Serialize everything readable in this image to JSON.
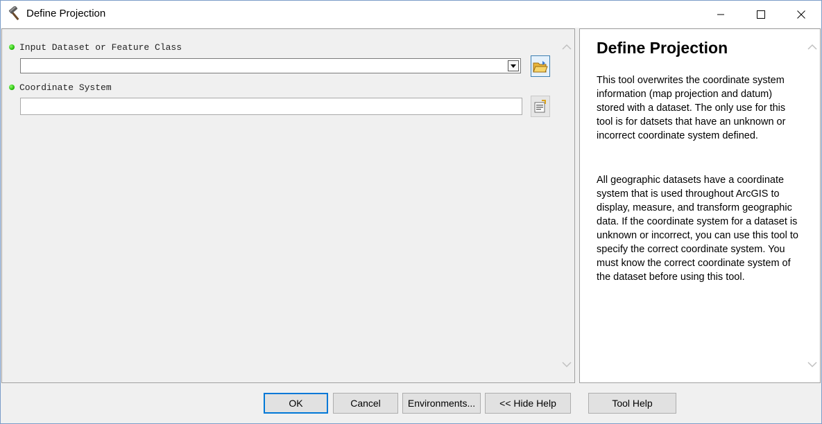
{
  "window": {
    "title": "Define Projection",
    "icon": "hammer-icon"
  },
  "parameters": {
    "input_label": "Input Dataset or Feature Class",
    "input_value": "",
    "coord_label": "Coordinate System",
    "coord_value": ""
  },
  "help": {
    "title": "Define Projection",
    "paragraph1": "This tool overwrites the coordinate system information (map projection and datum) stored with a dataset. The only use for this tool is for datsets that have an unknown or incorrect coordinate system defined.",
    "paragraph2": "All geographic datasets have a coordinate system that is used throughout ArcGIS to display, measure, and transform geographic data. If the coordinate system for a dataset is unknown or incorrect, you can use this tool to specify the correct coordinate system. You must know the correct coordinate system of the dataset before using this tool."
  },
  "buttons": {
    "ok": "OK",
    "cancel": "Cancel",
    "environments": "Environments...",
    "hide_help": "<< Hide Help",
    "tool_help": "Tool Help"
  },
  "colors": {
    "required_indicator": "#1bb300",
    "default_button_border": "#0078d7"
  }
}
